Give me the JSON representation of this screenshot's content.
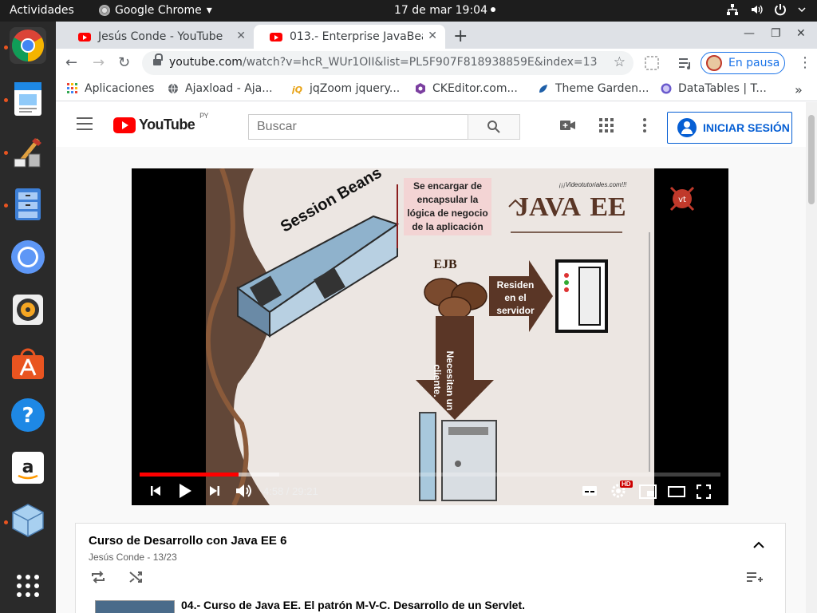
{
  "topbar": {
    "activities": "Actividades",
    "app_name": "Google Chrome",
    "app_arrow": "▾",
    "clock": "17 de mar  19:04"
  },
  "dock": {
    "items": [
      "chrome-icon",
      "document-viewer-icon",
      "image-editor-icon",
      "file-manager-icon",
      "chromium-icon",
      "audio-player-icon",
      "software-center-icon",
      "help-icon",
      "amazon-icon",
      "virtualbox-icon",
      "app-grid-icon"
    ]
  },
  "tabs": [
    {
      "title": "Jesús Conde - YouTube",
      "active": false
    },
    {
      "title": "013.- Enterprise JavaBean",
      "active": true
    }
  ],
  "toolbar": {
    "url_host": "youtube.com",
    "url_rest": "/watch?v=hcR_WUr1OII&list=PL5F907F818938859E&index=13",
    "profile_status": "En pausa"
  },
  "bookmarks": [
    {
      "label": "Aplicaciones",
      "icon": "apps-grid-icon"
    },
    {
      "label": "Ajaxload - Aja...",
      "icon": "globe-icon"
    },
    {
      "label": "jqZoom jquery...",
      "icon": "jq-icon"
    },
    {
      "label": "CKEditor.com...",
      "icon": "ckeditor-icon"
    },
    {
      "label": "Theme Garden...",
      "icon": "theme-icon"
    },
    {
      "label": "DataTables | T...",
      "icon": "datatables-icon"
    }
  ],
  "youtube": {
    "logo_text": "YouTube",
    "region": "PY",
    "search_placeholder": "Buscar",
    "signin_label": "INICIAR SESIÓN"
  },
  "video": {
    "slide_texts": {
      "session_beans": "Session Beans",
      "encapsulate": "Se encargar de encapsular la lógica de negocio de la aplicación",
      "ejb": "EJB",
      "server": "Residen en el servidor",
      "client": "Necesitan un cliente.",
      "site": "¡¡¡Videotutoriales.com!!!",
      "java": "JAVA",
      "ee": "EE"
    },
    "time": "4:58 / 29:21",
    "played_fraction": 0.17,
    "buffered_fraction": 0.24,
    "hd_badge": "HD"
  },
  "playlist": {
    "title": "Curso de Desarrollo con Java EE 6",
    "author": "Jesús Conde",
    "count": "13/23",
    "next_item": "04.- Curso de Java EE. El patrón M-V-C. Desarrollo de un Servlet."
  },
  "colors": {
    "youtube_red": "#ff0000",
    "link_blue": "#065fd4",
    "slide_brown": "#5a3626"
  }
}
